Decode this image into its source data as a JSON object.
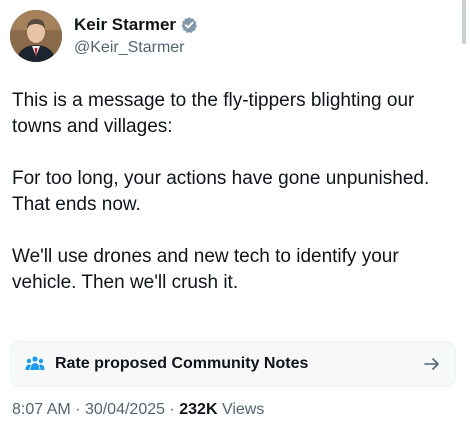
{
  "author": {
    "display_name": "Keir Starmer",
    "handle": "@Keir_Starmer",
    "verified_badge_icon": "verified-badge-icon",
    "badge_color": "#829aab"
  },
  "tweet": {
    "paragraphs": [
      "This is a message to the fly-tippers blighting our towns and villages:",
      "For too long, your actions have gone unpunished. That ends now.",
      "We'll use drones and new tech to identify your vehicle. Then we'll crush it."
    ]
  },
  "community_notes": {
    "label": "Rate proposed Community Notes",
    "icon": "community-notes-icon",
    "arrow_icon": "arrow-right-icon",
    "accent_color": "#1d9bf0"
  },
  "meta": {
    "time": "8:07 AM",
    "separator": "·",
    "date": "30/04/2025",
    "views_count": "232K",
    "views_label": "Views"
  }
}
